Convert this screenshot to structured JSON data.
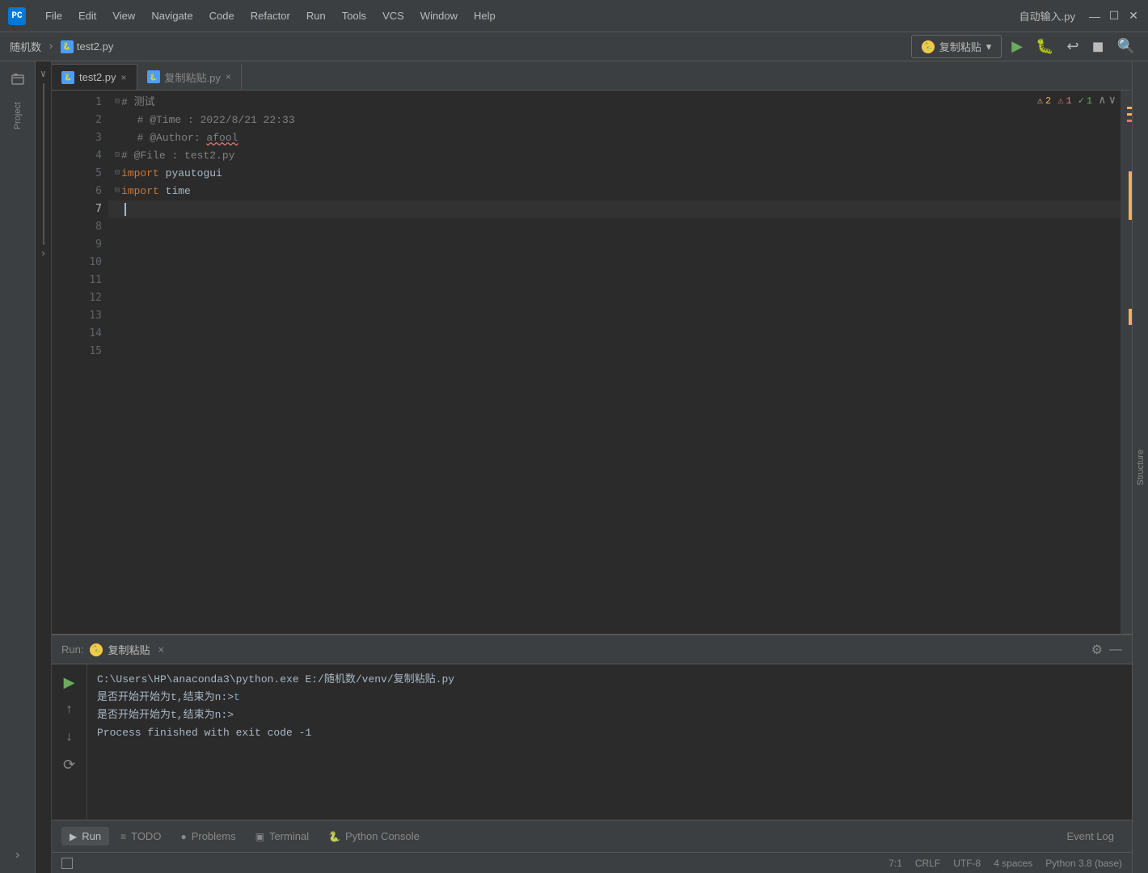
{
  "titlebar": {
    "app_icon": "PC",
    "menus": [
      "File",
      "Edit",
      "View",
      "Navigate",
      "Code",
      "Refactor",
      "Run",
      "Tools",
      "VCS",
      "Window",
      "Help"
    ],
    "filename": "自动输入.py",
    "min": "—",
    "max": "☐",
    "close": "✕"
  },
  "breadcrumb": {
    "folder": "随机数",
    "sep": "›",
    "file": "test2.py",
    "run_btn": "复制粘贴",
    "run_dropdown": "▾"
  },
  "tabs": [
    {
      "label": "test2.py",
      "active": true,
      "close": "×"
    },
    {
      "label": "复制粘贴.py",
      "active": false,
      "close": "×"
    }
  ],
  "warnings": {
    "warn_count": "2",
    "warn_icon": "⚠",
    "err_count": "1",
    "err_icon": "⚠",
    "ok_count": "1",
    "ok_icon": "✓"
  },
  "lines": [
    {
      "num": "1",
      "content": "#  测试",
      "fold": true
    },
    {
      "num": "2",
      "content": "  # @Time : 2022/8/21 22:33",
      "fold": false
    },
    {
      "num": "3",
      "content": "  # @Author: afool",
      "fold": false
    },
    {
      "num": "4",
      "content": "#  @File : test2.py",
      "fold": true
    },
    {
      "num": "5",
      "content": "import pyautogui",
      "fold": true
    },
    {
      "num": "6",
      "content": "import time",
      "fold": true
    },
    {
      "num": "7",
      "content": "",
      "fold": false,
      "current": true
    },
    {
      "num": "8",
      "content": "",
      "fold": false
    },
    {
      "num": "9",
      "content": "",
      "fold": false
    },
    {
      "num": "10",
      "content": "",
      "fold": false
    },
    {
      "num": "11",
      "content": "",
      "fold": false
    },
    {
      "num": "12",
      "content": "",
      "fold": false
    },
    {
      "num": "13",
      "content": "",
      "fold": false
    },
    {
      "num": "14",
      "content": "",
      "fold": false
    },
    {
      "num": "15",
      "content": "",
      "fold": false
    }
  ],
  "bottom_panel": {
    "run_label": "Run:",
    "tab_label": "复制粘贴",
    "close": "×",
    "terminal_lines": [
      "C:\\Users\\HP\\anaconda3\\python.exe E:/随机数/venv/复制粘贴.py",
      "是否开始开始为t,结束为n:>t",
      "是否开始开始为t,结束为n:>",
      "Process finished with exit code -1"
    ],
    "input_value": "t"
  },
  "bottom_tabs": [
    {
      "icon": "▶",
      "label": "Run",
      "active": true
    },
    {
      "icon": "≡",
      "label": "TODO",
      "active": false
    },
    {
      "icon": "●",
      "label": "Problems",
      "active": false
    },
    {
      "icon": "▣",
      "label": "Terminal",
      "active": false
    },
    {
      "icon": "🐍",
      "label": "Python Console",
      "active": false
    }
  ],
  "status_bar": {
    "position": "7:1",
    "line_ending": "CRLF",
    "encoding": "UTF-8",
    "indent": "4 spaces",
    "python": "Python 3.8 (base)",
    "event_log": "Event Log",
    "search_icon": "🔍"
  },
  "sidebar_left": {
    "project_icon": "📁",
    "label": "Project"
  }
}
